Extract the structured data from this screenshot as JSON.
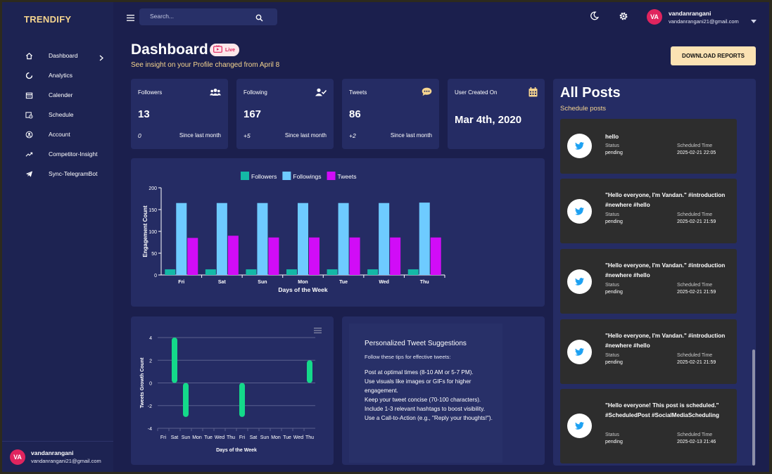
{
  "brand": "TRENDIFY",
  "sidebar": {
    "items": [
      {
        "label": "Dashboard",
        "icon": "home-icon"
      },
      {
        "label": "Analytics",
        "icon": "analytics-icon"
      },
      {
        "label": "Calender",
        "icon": "calendar-icon"
      },
      {
        "label": "Schedule",
        "icon": "schedule-icon"
      },
      {
        "label": "Account",
        "icon": "account-icon"
      },
      {
        "label": "Competitor-Insight",
        "icon": "trending-icon"
      },
      {
        "label": "Sync-TelegramBot",
        "icon": "telegram-icon"
      }
    ],
    "user": {
      "initials": "VA",
      "name": "vandanrangani",
      "email": "vandanrangani21@gmail.com"
    }
  },
  "topbar": {
    "search_placeholder": "Search...",
    "user": {
      "initials": "VA",
      "name": "vandanrangani",
      "email": "vandanrangani21@gmail.com"
    }
  },
  "header": {
    "title": "Dashboard",
    "live_label": "Live",
    "subtitle": "See insight on your Profile changed from April 8",
    "download_label": "DOWNLOAD REPORTS"
  },
  "stats": [
    {
      "title": "Followers",
      "value": "13",
      "delta": "0",
      "since": "Since last month"
    },
    {
      "title": "Following",
      "value": "167",
      "delta": "+5",
      "since": "Since last month"
    },
    {
      "title": "Tweets",
      "value": "86",
      "delta": "+2",
      "since": "Since last month"
    },
    {
      "title": "User Created On",
      "value": "Mar 4th, 2020"
    }
  ],
  "chart_data": [
    {
      "type": "bar",
      "categories": [
        "Fri",
        "Sat",
        "Sun",
        "Mon",
        "Tue",
        "Wed",
        "Thu"
      ],
      "series": [
        {
          "name": "Followers",
          "color": "#14b8a6",
          "values": [
            13,
            13,
            13,
            13,
            13,
            13,
            13
          ]
        },
        {
          "name": "Followings",
          "color": "#6ecbff",
          "values": [
            165,
            165,
            165,
            165,
            165,
            165,
            166
          ]
        },
        {
          "name": "Tweets",
          "color": "#d10cf7",
          "values": [
            85,
            90,
            86,
            86,
            86,
            86,
            86
          ]
        }
      ],
      "xlabel": "Days of the Week",
      "ylabel": "Engagement Count",
      "ylim": [
        0,
        200
      ],
      "yticks": [
        0,
        50,
        100,
        150,
        200
      ],
      "legend": "top"
    },
    {
      "type": "bar",
      "categories": [
        "Fri",
        "Sat",
        "Sun",
        "Mon",
        "Tue",
        "Wed",
        "Thu",
        "Fri",
        "Sat",
        "Sun",
        "Mon",
        "Tue",
        "Wed",
        "Thu"
      ],
      "series": [
        {
          "color": "#14d98a",
          "values": [
            0,
            4,
            -3,
            0,
            0,
            0,
            0,
            -3,
            0,
            0,
            0,
            0,
            0,
            2
          ]
        }
      ],
      "xlabel": "Days of the Week",
      "ylabel": "Tweets Growth Count",
      "ylim": [
        -4,
        4
      ],
      "yticks": [
        -4,
        -2,
        0,
        2,
        4
      ]
    }
  ],
  "tips": {
    "title": "Personalized Tweet Suggestions",
    "subtitle": "Follow these tips for effective tweets:",
    "items": [
      "Post at optimal times (8-10 AM or 5-7 PM).",
      "Use visuals like images or GIFs for higher engagement.",
      "Keep your tweet concise (70-100 characters).",
      "Include 1-3 relevant hashtags to boost visibility.",
      "Use a Call-to-Action (e.g., \"Reply your thoughts!\")."
    ]
  },
  "posts": {
    "title": "All Posts",
    "subtitle": "Schedule posts",
    "status_label": "Status",
    "time_label": "Scheduled Time",
    "items": [
      {
        "text": "hello",
        "status": "pending",
        "time": "2025-02-21 22:05"
      },
      {
        "text": "\"Hello everyone, I'm Vandan.\" #introduction #newhere #hello",
        "status": "pending",
        "time": "2025-02-21 21:59"
      },
      {
        "text": "\"Hello everyone, I'm Vandan.\" #introduction #newhere #hello",
        "status": "pending",
        "time": "2025-02-21 21:59"
      },
      {
        "text": "\"Hello everyone, I'm Vandan.\" #introduction #newhere #hello",
        "status": "pending",
        "time": "2025-02-21 21:59"
      },
      {
        "text": "\"Hello everyone! This post is scheduled.\" #ScheduledPost #SocialMediaScheduling",
        "status": "pending",
        "time": "2025-02-13 21:46"
      }
    ]
  },
  "colors": {
    "accent": "#f6d58f",
    "bg": "#1b1f4d",
    "card": "#252c64",
    "live": "#e0245e",
    "twitter": "#1da1f2"
  }
}
